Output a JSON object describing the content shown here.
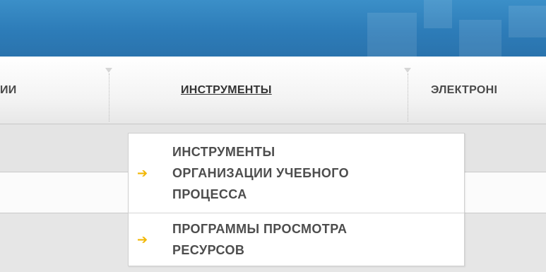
{
  "nav": {
    "items": [
      {
        "label": "ИИ",
        "active": false
      },
      {
        "label": "ИНСТРУМЕНТЫ",
        "active": true
      },
      {
        "label": "ЭЛЕКТРОНІ",
        "active": false
      }
    ]
  },
  "dropdown": {
    "items": [
      {
        "icon": "right-arrow-icon",
        "lines": [
          "ИНСТРУМЕНТЫ",
          "ОРГАНИЗАЦИИ УЧЕБНОГО",
          "ПРОЦЕССА"
        ]
      },
      {
        "icon": "right-arrow-icon",
        "lines": [
          "ПРОГРАММЫ ПРОСМОТРА",
          "РЕСУРСОВ"
        ]
      }
    ]
  },
  "colors": {
    "banner": "#2d7cb8",
    "arrow": "#f2b705",
    "text": "#4d4d4d"
  }
}
